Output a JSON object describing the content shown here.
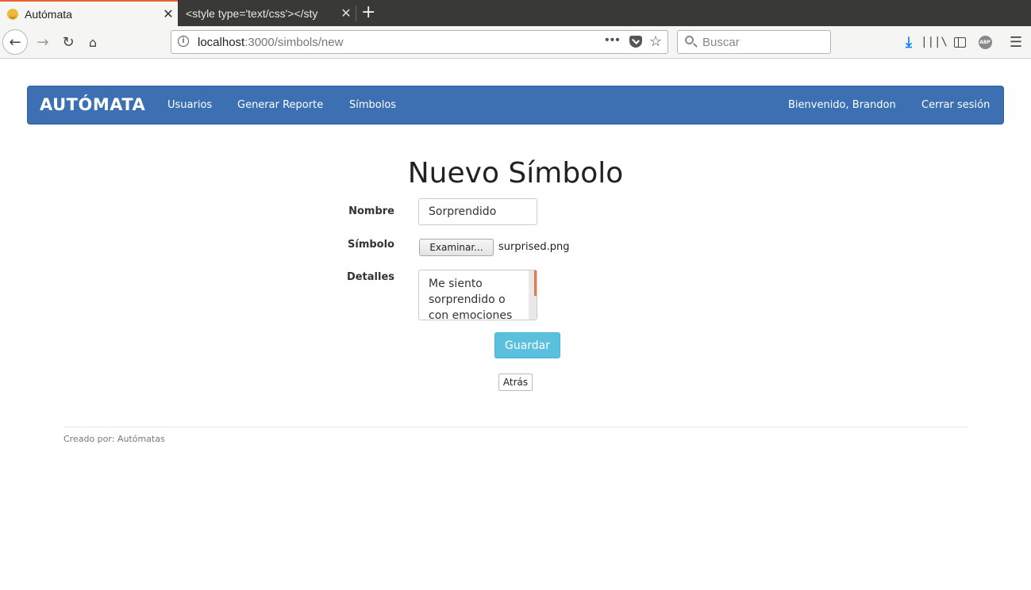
{
  "browser": {
    "tabs": [
      {
        "title": "Autómata",
        "active": true
      },
      {
        "title": "<style type='text/css'></sty",
        "active": false
      }
    ],
    "url_host": "localhost",
    "url_path": ":3000/simbols/new",
    "search_placeholder": "Buscar",
    "icons": {
      "back": "←",
      "forward": "→",
      "reload": "↻",
      "home": "⌂",
      "new_tab": "+",
      "close": "✕",
      "url_more": "•••",
      "star": "☆",
      "download": "⤓",
      "library": "|||\\",
      "abp": "ABP",
      "menu": "☰"
    }
  },
  "navbar": {
    "brand": "AUTÓMATA",
    "links": [
      "Usuarios",
      "Generar Reporte",
      "Símbolos"
    ],
    "welcome": "Bienvenido, Brandon",
    "logout": "Cerrar sesión",
    "bg_color": "#3c70b3"
  },
  "form": {
    "title": "Nuevo Símbolo",
    "nombre_label": "Nombre",
    "nombre_value": "Sorprendido",
    "simbolo_label": "Símbolo",
    "file_button": "Examinar...",
    "file_name": "surprised.png",
    "detalles_label": "Detalles",
    "detalles_value": "Me siento sorprendido o con emociones",
    "save_button": "Guardar",
    "back_button": "Atrás"
  },
  "footer": {
    "text": "Creado por: Autómatas"
  }
}
